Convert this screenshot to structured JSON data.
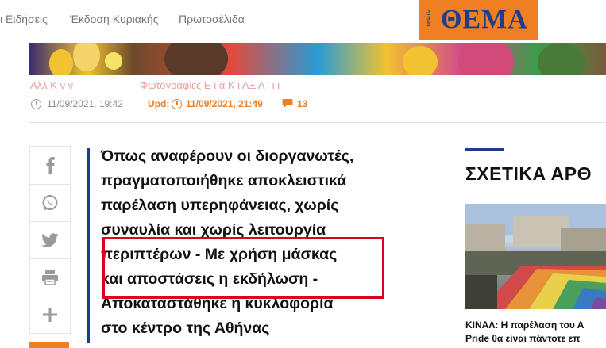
{
  "nav": {
    "items": [
      "ι Ειδήσεις",
      "Έκδοση Κυριακής",
      "Πρωτοσέλιδα"
    ]
  },
  "logo": {
    "word": "ΘΕΜΑ",
    "small": "ΠΡΩΤΟ"
  },
  "faded_links": {
    "left": "Αλλ Κ ν ν",
    "right": "Φωτογραφίες Ε  ι  ά  Κ  ι  ΛΞ  Λ ' ι ι"
  },
  "meta": {
    "published": "11/09/2021, 19:42",
    "updated_label": "Upd:",
    "updated": "11/09/2021, 21:49",
    "comments": "13"
  },
  "share": [
    "facebook",
    "whatsapp",
    "twitter",
    "print",
    "more"
  ],
  "lead": {
    "lines": [
      "Όπως αναφέρουν οι διοργανωτές,",
      "πραγματοποιήθηκε αποκλειστικά",
      "παρέλαση υπερηφάνειας, χωρίς",
      "συναυλία και χωρίς λειτουργία",
      "περιπτέρων - Με χρήση μάσκας",
      "και αποστάσεις η εκδήλωση -",
      "Αποκαταστάθηκε η κυκλοφορία",
      "στο κέντρο της Αθήνας"
    ]
  },
  "related": {
    "title": "ΣΧΕΤΙΚΑ ΑΡΘ",
    "caption_line1": "ΚΙΝΑΛ: Η παρέλαση του Α",
    "caption_line2": "Pride θα είναι πάντοτε επ"
  },
  "colors": {
    "accent_orange": "#f07e22",
    "brand_blue": "#1b3f8e",
    "highlight_red": "#e0001a"
  }
}
